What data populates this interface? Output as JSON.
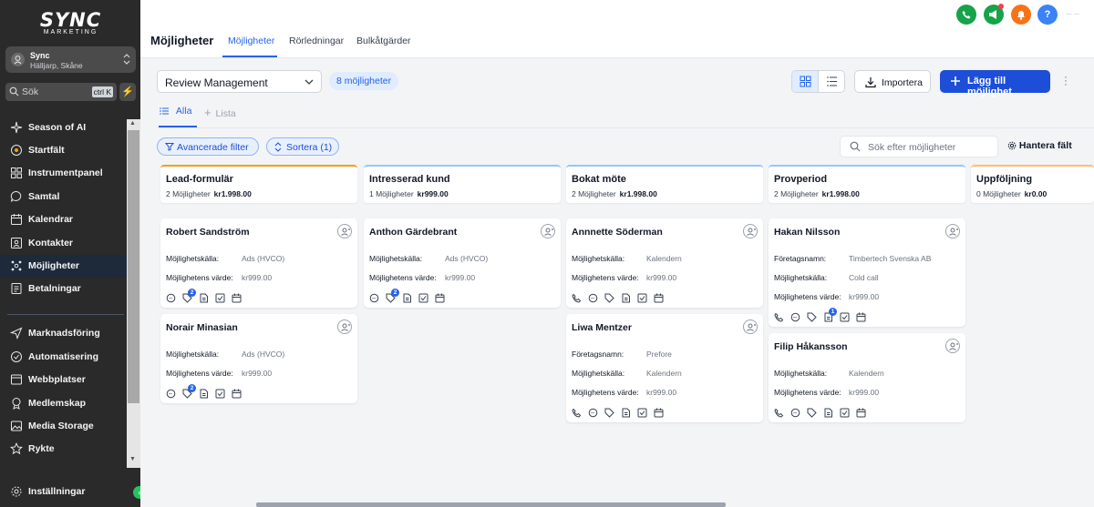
{
  "brand": {
    "logo_main": "SYNC",
    "logo_sub": "MARKETING"
  },
  "location": {
    "name": "Sync",
    "sub": "Hälljarp, Skåne"
  },
  "sidebar_search": {
    "placeholder": "Sök",
    "shortcut": "ctrl K"
  },
  "sidebar": {
    "items": [
      {
        "label": "Season of AI",
        "icon": "sparkle-icon"
      },
      {
        "label": "Startfält",
        "icon": "launchpad-icon"
      },
      {
        "label": "Instrumentpanel",
        "icon": "dashboard-icon"
      },
      {
        "label": "Samtal",
        "icon": "chat-icon"
      },
      {
        "label": "Kalendrar",
        "icon": "calendar-icon"
      },
      {
        "label": "Kontakter",
        "icon": "contacts-icon"
      },
      {
        "label": "Möjligheter",
        "icon": "opportunities-icon",
        "active": true
      },
      {
        "label": "Betalningar",
        "icon": "payments-icon"
      },
      {
        "label": "Marknadsföring",
        "icon": "send-icon"
      },
      {
        "label": "Automatisering",
        "icon": "automation-icon"
      },
      {
        "label": "Webbplatser",
        "icon": "globe-icon"
      },
      {
        "label": "Medlemskap",
        "icon": "membership-icon"
      },
      {
        "label": "Media Storage",
        "icon": "media-icon"
      },
      {
        "label": "Rykte",
        "icon": "star-icon"
      }
    ],
    "settings_label": "Inställningar"
  },
  "header": {
    "title": "Möjligheter",
    "tabs": [
      "Möjligheter",
      "Rörledningar",
      "Bulkåtgärder"
    ],
    "help": "?"
  },
  "toolbar": {
    "pipeline": "Review Management",
    "count": "8 möjligheter",
    "import_label": "Importera",
    "add_label": "Lägg till möjlighet"
  },
  "view_tabs": {
    "all": "Alla",
    "list": "Lista"
  },
  "filters": {
    "advanced": "Avancerade filter",
    "sort": "Sortera (1)",
    "search_placeholder": "Sök efter möjligheter",
    "manage_fields": "Hantera fält"
  },
  "columns": [
    {
      "title": "Lead-formulär",
      "count": "2 Möjligheter",
      "value": "kr1.998.00",
      "color": "#f59e0b"
    },
    {
      "title": "Intresserad kund",
      "count": "1 Möjligheter",
      "value": "kr999.00",
      "color": "#93c5fd"
    },
    {
      "title": "Bokat möte",
      "count": "2 Möjligheter",
      "value": "kr1.998.00",
      "color": "#93c5fd"
    },
    {
      "title": "Provperiod",
      "count": "2 Möjligheter",
      "value": "kr1.998.00",
      "color": "#93c5fd"
    },
    {
      "title": "Uppföljning",
      "count": "0 Möjligheter",
      "value": "kr0.00",
      "color": "#fdba74"
    }
  ],
  "cards": {
    "robert": {
      "name": "Robert Sandström",
      "f1_label": "Möjlighetskälla:",
      "f1_value": "Ads (HVCO)",
      "f2_label": "Möjlighetens värde:",
      "f2_value": "kr999.00",
      "badge": "2"
    },
    "norair": {
      "name": "Norair Minasian",
      "f1_label": "Möjlighetskälla:",
      "f1_value": "Ads (HVCO)",
      "f2_label": "Möjlighetens värde:",
      "f2_value": "kr999.00",
      "badge": "2"
    },
    "anthon": {
      "name": "Anthon Gärdebrant",
      "f1_label": "Möjlighetskälla:",
      "f1_value": "Ads (HVCO)",
      "f2_label": "Möjlighetens värde:",
      "f2_value": "kr999.00",
      "badge": "2"
    },
    "annette": {
      "name": "Annnette Söderman",
      "f1_label": "Möjlighetskälla:",
      "f1_value": "Kalendern",
      "f2_label": "Möjlighetens värde:",
      "f2_value": "kr999.00"
    },
    "liwa": {
      "name": "Liwa Mentzer",
      "f0_label": "Företagsnamn:",
      "f0_value": "Prefore",
      "f1_label": "Möjlighetskälla:",
      "f1_value": "Kalendern",
      "f2_label": "Möjlighetens värde:",
      "f2_value": "kr999.00"
    },
    "hakan": {
      "name": "Hakan Nilsson",
      "f0_label": "Företagsnamn:",
      "f0_value": "Timbertech Svenska AB",
      "f1_label": "Möjlighetskälla:",
      "f1_value": "Cold call",
      "f2_label": "Möjlighetens värde:",
      "f2_value": "kr999.00",
      "badge": "1"
    },
    "filip": {
      "name": "Filip Håkansson",
      "f1_label": "Möjlighetskälla:",
      "f1_value": "Kalendern",
      "f2_label": "Möjlighetens värde:",
      "f2_value": "kr999.00"
    }
  },
  "colors": {
    "accent": "#2563eb",
    "sidebar": "#2a2a2a",
    "active_nav": "#1e2a3a"
  }
}
